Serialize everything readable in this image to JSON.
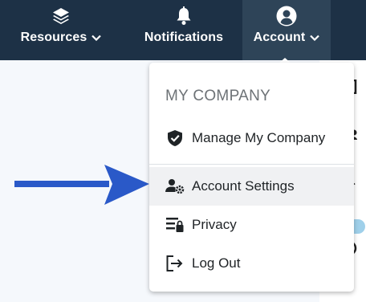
{
  "topbar": {
    "resources": {
      "label": "Resources",
      "icon": "layers-icon"
    },
    "notifications": {
      "label": "Notifications",
      "icon": "bell-icon"
    },
    "account": {
      "label": "Account",
      "icon": "user-circle-icon"
    }
  },
  "dropdown": {
    "heading": "MY COMPANY",
    "items": [
      {
        "label": "Manage My Company",
        "icon": "shield-check-icon"
      },
      {
        "label": "Account Settings",
        "icon": "user-gear-icon",
        "active": true
      },
      {
        "label": "Privacy",
        "icon": "privacy-lock-icon"
      },
      {
        "label": "Log Out",
        "icon": "logout-icon"
      }
    ]
  },
  "annotation": {
    "arrow_color": "#2a59c8"
  },
  "colors": {
    "topbar": "#1d3146",
    "topbar_active": "#2e4458",
    "hover": "#f0f1f3"
  }
}
